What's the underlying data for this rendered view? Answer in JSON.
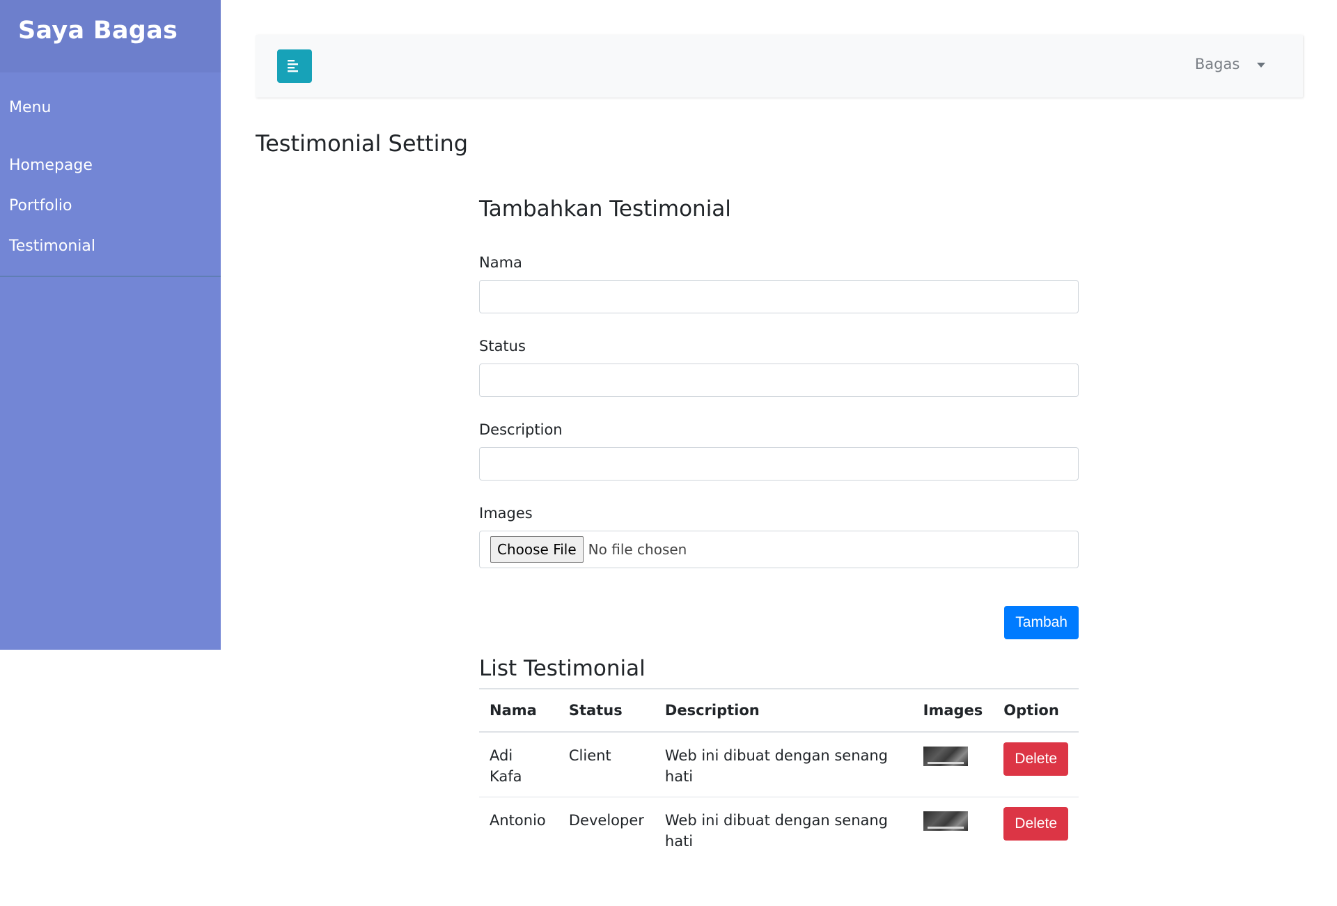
{
  "sidebar": {
    "brand": "Saya Bagas",
    "menu_heading": "Menu",
    "items": [
      {
        "label": "Homepage"
      },
      {
        "label": "Portfolio"
      },
      {
        "label": "Testimonial"
      }
    ]
  },
  "navbar": {
    "toggle_icon": "align-left-icon",
    "user_name": "Bagas"
  },
  "page": {
    "title": "Testimonial Setting"
  },
  "form": {
    "heading": "Tambahkan Testimonial",
    "fields": {
      "nama": {
        "label": "Nama",
        "value": ""
      },
      "status": {
        "label": "Status",
        "value": ""
      },
      "description": {
        "label": "Description",
        "value": ""
      },
      "images": {
        "label": "Images",
        "button": "Choose File",
        "status": "No file chosen"
      }
    },
    "submit_label": "Tambah"
  },
  "list": {
    "heading": "List Testimonial",
    "columns": [
      "Nama",
      "Status",
      "Description",
      "Images",
      "Option"
    ],
    "rows": [
      {
        "nama": "Adi Kafa",
        "status": "Client",
        "description": "Web ini dibuat dengan senang hati",
        "image": "thumbnail-image",
        "action": "Delete"
      },
      {
        "nama": "Antonio",
        "status": "Developer",
        "description": "Web ini dibuat dengan senang hati",
        "image": "thumbnail-image",
        "action": "Delete"
      }
    ]
  },
  "colors": {
    "sidebar_bg": "#7386d5",
    "sidebar_header_bg": "#6d7fcc",
    "toggle_bg": "#17a2b8",
    "primary": "#007bff",
    "danger": "#dc3545"
  }
}
